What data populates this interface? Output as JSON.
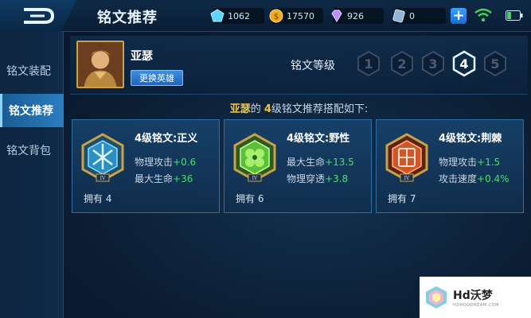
{
  "header": {
    "title": "铭文推荐",
    "resources": [
      {
        "icon": "diamond-icon",
        "value": "1062"
      },
      {
        "icon": "gold-coin-icon",
        "value": "17570"
      },
      {
        "icon": "gem-icon",
        "value": "926"
      },
      {
        "icon": "ticket-icon",
        "value": "0"
      }
    ]
  },
  "sidebar": {
    "items": [
      {
        "label": "铭文装配",
        "active": false
      },
      {
        "label": "铭文推荐",
        "active": true
      },
      {
        "label": "铭文背包",
        "active": false
      }
    ]
  },
  "hero": {
    "name": "亚瑟",
    "change_label": "更换英雄",
    "level_label": "铭文等级",
    "levels": [
      "1",
      "2",
      "3",
      "4",
      "5"
    ],
    "selected_level": "4"
  },
  "recommend": {
    "hero": "亚瑟",
    "mid": "的 ",
    "level": "4",
    "suffix": "级铭文推荐搭配如下:"
  },
  "cards": [
    {
      "name": "4级铭文:正义",
      "color": "#2b8fc4",
      "stats": [
        {
          "label": "物理攻击",
          "value": "+0.6"
        },
        {
          "label": "最大生命",
          "value": "+36"
        }
      ],
      "owned": "拥有 4"
    },
    {
      "name": "4级铭文:野性",
      "color": "#5cbf3a",
      "stats": [
        {
          "label": "最大生命",
          "value": "+13.5"
        },
        {
          "label": "物理穿透",
          "value": "+3.8"
        }
      ],
      "owned": "拥有 6"
    },
    {
      "name": "4级铭文:荆棘",
      "color": "#d0562a",
      "stats": [
        {
          "label": "物理攻击",
          "value": "+1.5"
        },
        {
          "label": "攻击速度",
          "value": "+0.4%"
        }
      ],
      "owned": "拥有 7"
    }
  ],
  "watermark": {
    "main": "Hd沃梦",
    "sub": "HDHOODREAM.COM"
  }
}
